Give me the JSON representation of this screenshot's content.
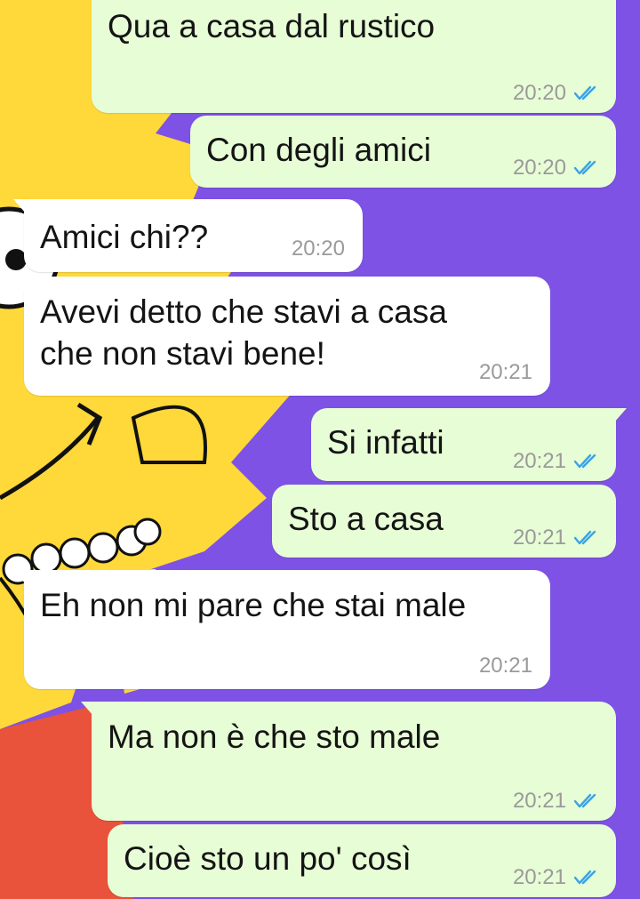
{
  "colors": {
    "outgoing_bubble": "#e7fdd6",
    "incoming_bubble": "#ffffff",
    "read_check": "#3aa3e4",
    "wallpaper_purple": "#7d52e4",
    "wallpaper_yellow": "#ffd83a"
  },
  "messages": [
    {
      "direction": "outgoing",
      "text": "Qua a casa dal rustico",
      "time": "20:20",
      "status": "read-double-check-icon"
    },
    {
      "direction": "outgoing",
      "text": "Con degli amici",
      "time": "20:20",
      "status": "read-double-check-icon"
    },
    {
      "direction": "incoming",
      "text": "Amici chi??",
      "time": "20:20"
    },
    {
      "direction": "incoming",
      "text_line1": "Avevi detto che stavi a casa",
      "text_line2": "che non stavi bene!",
      "time": "20:21"
    },
    {
      "direction": "outgoing",
      "text": "Si infatti",
      "time": "20:21",
      "status": "read-double-check-icon"
    },
    {
      "direction": "outgoing",
      "text": "Sto a casa",
      "time": "20:21",
      "status": "read-double-check-icon"
    },
    {
      "direction": "incoming",
      "text": "Eh non mi pare che stai male",
      "time": "20:21"
    },
    {
      "direction": "outgoing",
      "text": "Ma non è che sto male",
      "time": "20:21",
      "status": "read-double-check-icon"
    },
    {
      "direction": "outgoing",
      "text": "Cioè sto un po' così",
      "time": "20:21",
      "status": "read-double-check-icon"
    }
  ]
}
